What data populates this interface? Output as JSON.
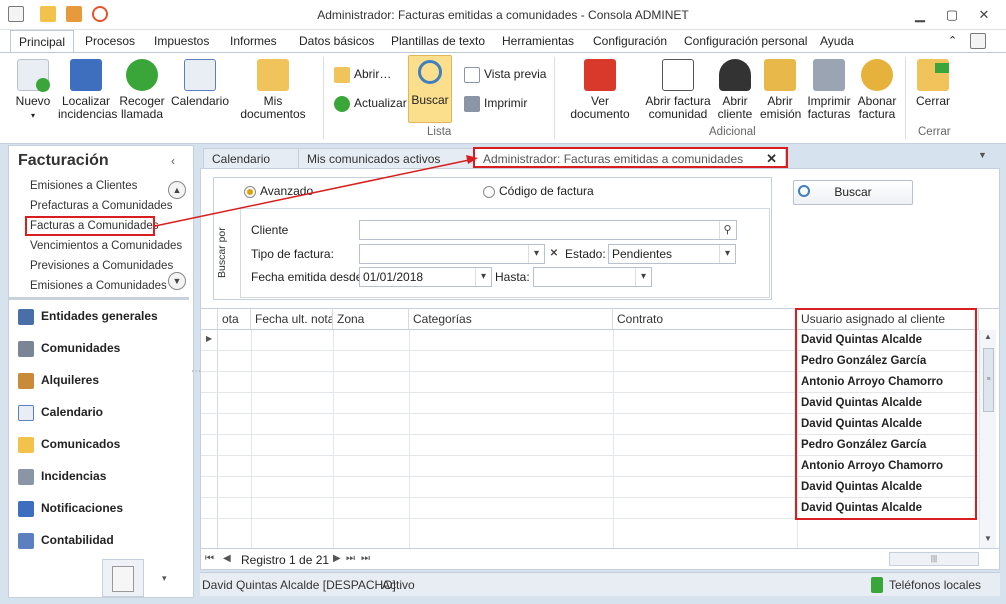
{
  "window": {
    "title": "Administrador: Facturas emitidas a comunidades - Consola ADMINET"
  },
  "menu_tabs": [
    "Principal",
    "Procesos",
    "Impuestos",
    "Informes",
    "Datos básicos",
    "Plantillas de texto",
    "Herramientas",
    "Configuración",
    "Configuración personal",
    "Ayuda"
  ],
  "ribbon": {
    "buttons": {
      "nuevo": "Nuevo",
      "localizar": "Localizar\nincidencias",
      "recoger": "Recoger\nllamada",
      "calendario": "Calendario",
      "documentos": "Mis documentos",
      "abrir": "Abrir…",
      "actualizar": "Actualizar",
      "buscar": "Buscar",
      "vista_previa": "Vista previa",
      "imprimir": "Imprimir",
      "ver_documento": "Ver documento",
      "abrir_factura": "Abrir factura\ncomunidad",
      "abrir_cliente": "Abrir\ncliente",
      "abrir_emision": "Abrir\nemisión",
      "imprimir_facturas": "Imprimir\nfacturas",
      "abonar_factura": "Abonar\nfactura",
      "cerrar": "Cerrar"
    },
    "groups": {
      "lista": "Lista",
      "adicional": "Adicional",
      "cerrar": "Cerrar"
    }
  },
  "left_panel": {
    "title": "Facturación",
    "items": [
      "Emisiones a Clientes",
      "Prefacturas a Comunidades",
      "Facturas a Comunidades",
      "Vencimientos a Comunidades",
      "Previsiones a Comunidades",
      "Emisiones a Comunidades"
    ],
    "selected_index": 2,
    "nav": [
      "Entidades generales",
      "Comunidades",
      "Alquileres",
      "Calendario",
      "Comunicados",
      "Incidencias",
      "Notificaciones",
      "Contabilidad"
    ]
  },
  "doc_tabs": [
    "Calendario",
    "Mis comunicados activos",
    "Administrador: Facturas emitidas a comunidades"
  ],
  "search": {
    "group_label": "Buscar por",
    "mode_options": [
      "Avanzado",
      "Código de factura"
    ],
    "selected_mode": "Avanzado",
    "button": "Buscar",
    "fields": {
      "cliente_label": "Cliente",
      "cliente_value": "",
      "tipo_label": "Tipo de factura:",
      "tipo_value": "",
      "estado_label": "Estado:",
      "estado_value": "Pendientes",
      "fecha_label": "Fecha emitida desde:",
      "fecha_value": "01/01/2018",
      "hasta_label": "Hasta:",
      "hasta_value": ""
    }
  },
  "grid": {
    "columns": [
      "ota",
      "Fecha ult. nota",
      "Zona",
      "Categorías",
      "Contrato",
      "Usuario asignado al cliente"
    ],
    "rows": [
      {
        "usuario": "David Quintas Alcalde"
      },
      {
        "usuario": "Pedro González García"
      },
      {
        "usuario": "Antonio Arroyo Chamorro"
      },
      {
        "usuario": "David Quintas Alcalde"
      },
      {
        "usuario": "David Quintas Alcalde"
      },
      {
        "usuario": "Pedro González García"
      },
      {
        "usuario": "Antonio Arroyo Chamorro"
      },
      {
        "usuario": "David Quintas Alcalde"
      },
      {
        "usuario": "David Quintas Alcalde"
      }
    ],
    "pager": "Registro 1 de 21"
  },
  "status": {
    "user": "David Quintas Alcalde [DESPACHO]",
    "state": "Activo",
    "phones": "Teléfonos locales"
  },
  "colors": {
    "highlight": "#d81e1e",
    "accent": "#1e4c8c",
    "buscar_active": "#fbdf8d"
  }
}
